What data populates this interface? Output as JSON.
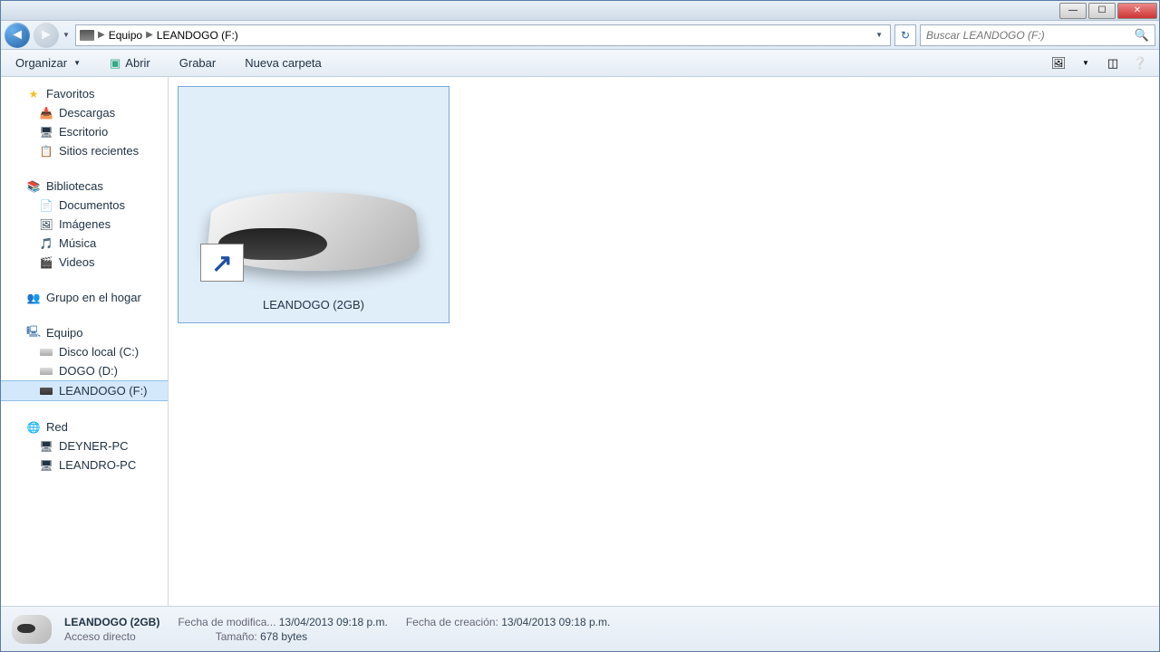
{
  "breadcrumb": {
    "part1": "Equipo",
    "part2": "LEANDOGO (F:)"
  },
  "search": {
    "placeholder": "Buscar LEANDOGO (F:)"
  },
  "toolbar": {
    "organize": "Organizar",
    "open": "Abrir",
    "burn": "Grabar",
    "newfolder": "Nueva carpeta"
  },
  "sidebar": {
    "favorites": {
      "header": "Favoritos",
      "items": [
        "Descargas",
        "Escritorio",
        "Sitios recientes"
      ]
    },
    "libraries": {
      "header": "Bibliotecas",
      "items": [
        "Documentos",
        "Imágenes",
        "Música",
        "Videos"
      ]
    },
    "homegroup": {
      "header": "Grupo en el hogar"
    },
    "computer": {
      "header": "Equipo",
      "items": [
        "Disco local (C:)",
        "DOGO (D:)",
        "LEANDOGO (F:)"
      ]
    },
    "network": {
      "header": "Red",
      "items": [
        "DEYNER-PC",
        "LEANDRO-PC"
      ]
    }
  },
  "file": {
    "name": "LEANDOGO (2GB)"
  },
  "status": {
    "name": "LEANDOGO (2GB)",
    "type": "Acceso directo",
    "modLabel": "Fecha de modifica...",
    "modVal": "13/04/2013 09:18 p.m.",
    "sizeLabel": "Tamaño:",
    "sizeVal": "678 bytes",
    "createLabel": "Fecha de creación:",
    "createVal": "13/04/2013 09:18 p.m."
  }
}
